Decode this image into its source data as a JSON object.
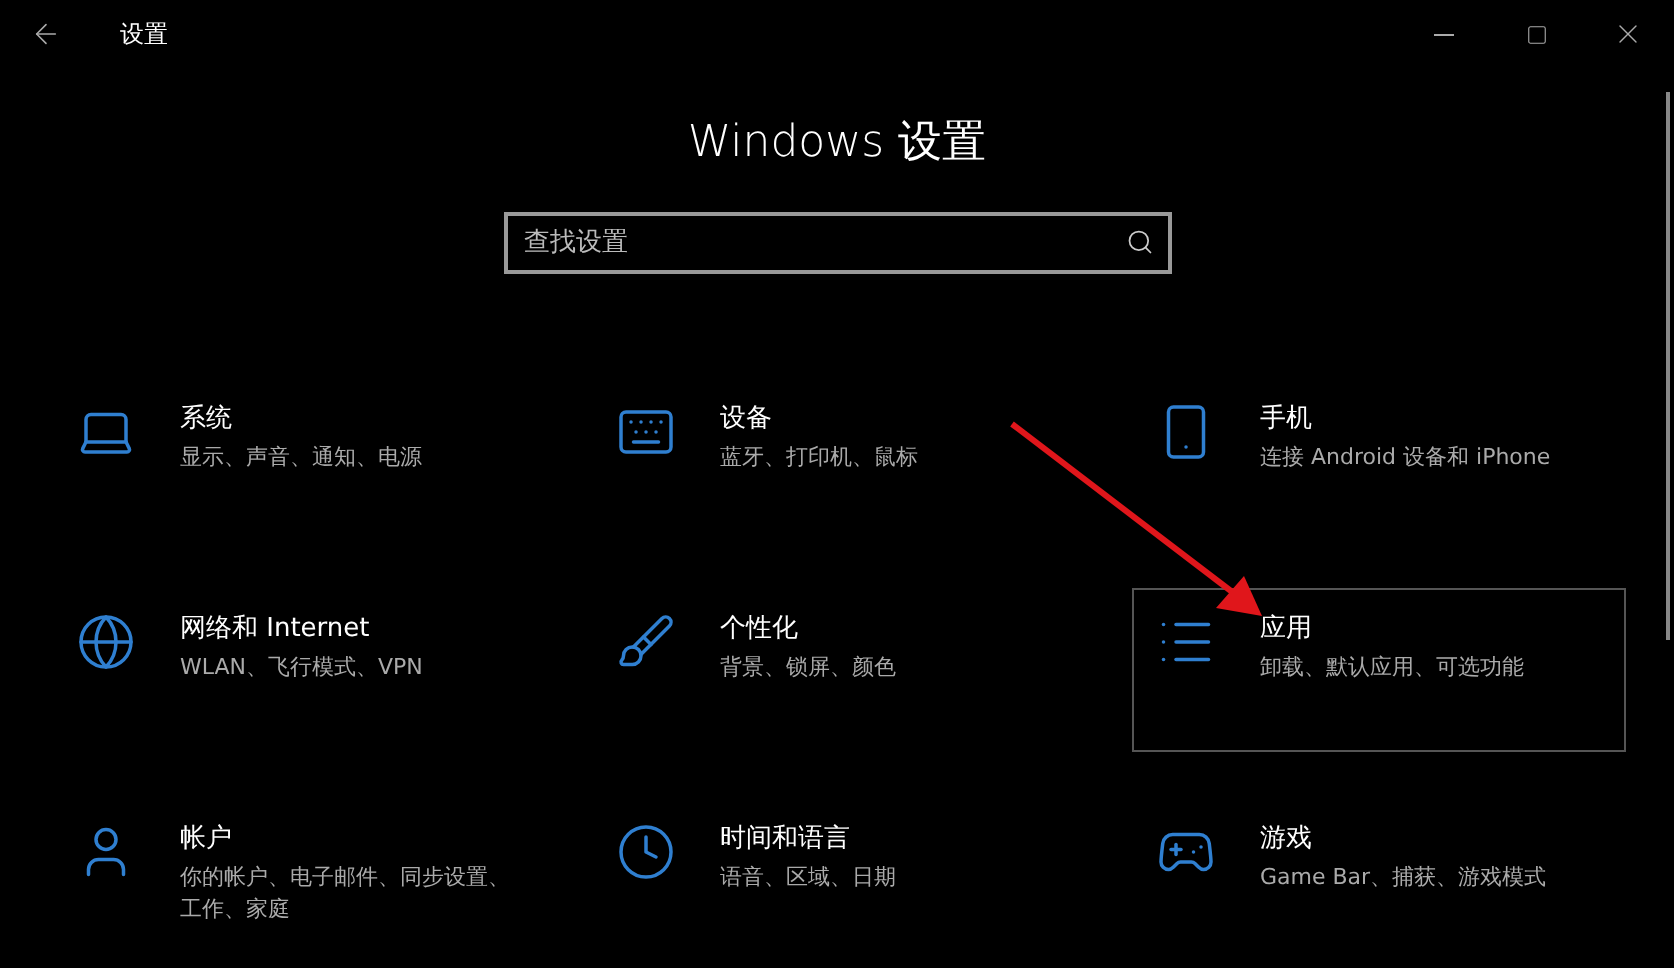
{
  "window": {
    "title": "设置"
  },
  "heading": "Windows 设置",
  "search": {
    "placeholder": "查找设置"
  },
  "categories": [
    {
      "title": "系统",
      "description": "显示、声音、通知、电源",
      "hovered": false
    },
    {
      "title": "设备",
      "description": "蓝牙、打印机、鼠标",
      "hovered": false
    },
    {
      "title": "手机",
      "description": "连接 Android 设备和 iPhone",
      "hovered": false
    },
    {
      "title": "网络和 Internet",
      "description": "WLAN、飞行模式、VPN",
      "hovered": false
    },
    {
      "title": "个性化",
      "description": "背景、锁屏、颜色",
      "hovered": false
    },
    {
      "title": "应用",
      "description": "卸载、默认应用、可选功能",
      "hovered": true
    },
    {
      "title": "帐户",
      "description": "你的帐户、电子邮件、同步设置、工作、家庭",
      "hovered": false
    },
    {
      "title": "时间和语言",
      "description": "语音、区域、日期",
      "hovered": false
    },
    {
      "title": "游戏",
      "description": "Game Bar、捕获、游戏模式",
      "hovered": false
    }
  ]
}
